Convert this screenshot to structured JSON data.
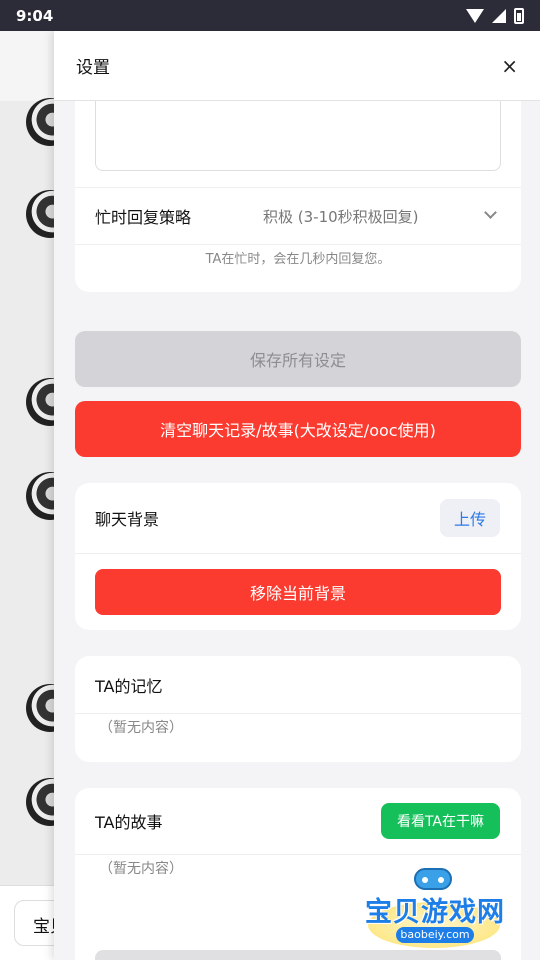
{
  "status_bar": {
    "time": "9:04"
  },
  "background": {
    "input_text": "宝贝"
  },
  "modal": {
    "title": "设置",
    "close_label": "×",
    "busy_reply": {
      "label": "忙时回复策略",
      "value": "积极 (3-10秒积极回复)",
      "hint": "TA在忙时，会在几秒内回复您。"
    },
    "save_button": "保存所有设定",
    "clear_button": "清空聊天记录/故事(大改设定/ooc使用)",
    "chat_background": {
      "label": "聊天背景",
      "upload_button": "上传",
      "remove_button": "移除当前背景"
    },
    "memory": {
      "label": "TA的记忆",
      "empty": "（暂无内容）"
    },
    "story": {
      "label": "TA的故事",
      "button": "看看TA在干嘛",
      "empty": "（暂无内容）"
    }
  },
  "watermark": {
    "brand": "宝贝游戏网",
    "url": "baobeiy.com"
  }
}
